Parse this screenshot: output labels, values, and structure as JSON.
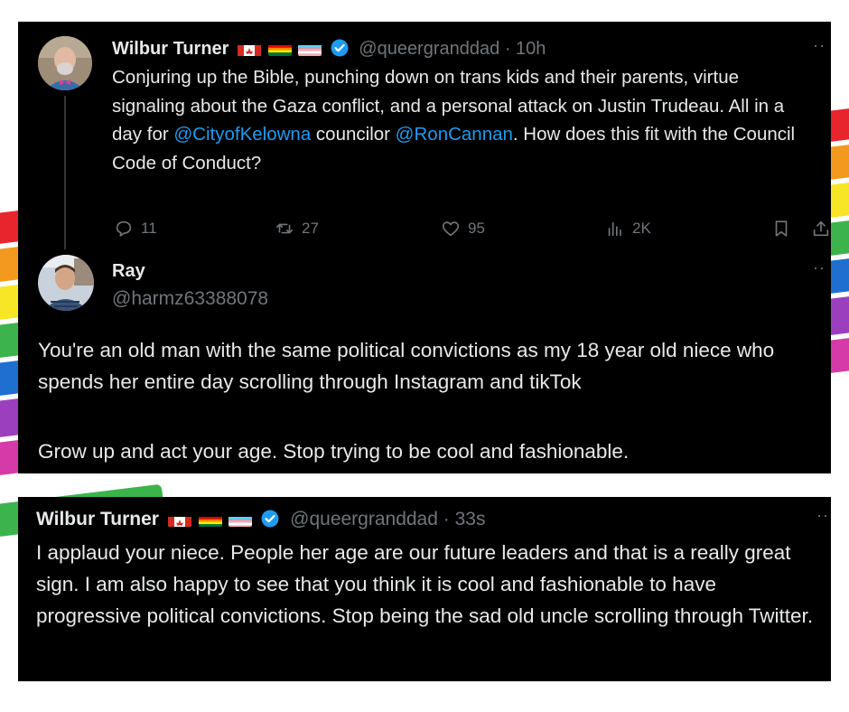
{
  "tweet1": {
    "name": "Wilbur Turner",
    "handle": "@queergranddad",
    "time": "· 10h",
    "text_before": "Conjuring up the Bible, punching down on trans kids and their parents, virtue signaling about the Gaza conflict, and a personal attack on Justin Trudeau. All in a day for ",
    "mention1": "@CityofKelowna",
    "text_middle": " councilor ",
    "mention2": "@RonCannan",
    "text_after": ". How does this fit with the Council Code of Conduct?",
    "replies": "11",
    "retweets": "27",
    "likes": "95",
    "views": "2K"
  },
  "tweet2": {
    "name": "Ray",
    "handle": "@harmz63388078",
    "paragraph1": "You're an old man with the same political convictions as my 18 year old niece who spends her entire day scrolling through Instagram and tikTok",
    "paragraph2": "Grow up and act your age. Stop trying to be cool and fashionable."
  },
  "tweet3": {
    "name": "Wilbur Turner",
    "handle": "@queergranddad",
    "time": "· 33s",
    "text": "I applaud your niece. People her age are our future leaders and that is a really great sign. I am also happy to see that you think it is cool and fashionable to have progressive political convictions. Stop being the sad old uncle scrolling through Twitter."
  },
  "more_label": "··",
  "colors": {
    "background": "#000000",
    "text": "#e7e9ea",
    "muted": "#71767b",
    "link": "#1d9bf0",
    "verified": "#1d9bf0"
  },
  "icons": [
    "reply-icon",
    "retweet-icon",
    "like-icon",
    "views-icon",
    "bookmark-icon",
    "share-icon",
    "verified-icon",
    "canada-flag-icon",
    "rainbow-flag-icon",
    "trans-flag-icon"
  ]
}
